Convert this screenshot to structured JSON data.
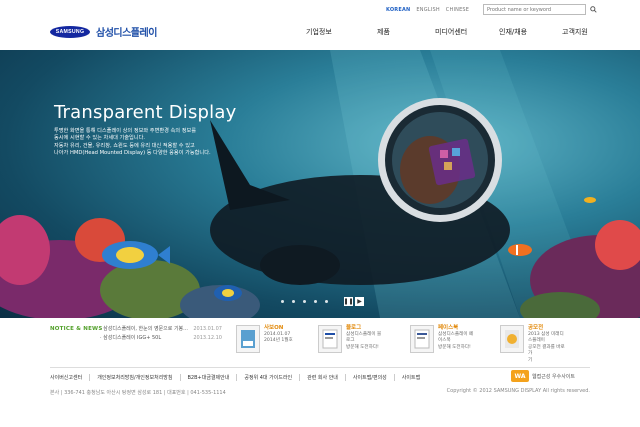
{
  "header": {
    "languages": [
      "KOREAN",
      "ENGLISH",
      "CHINESE"
    ],
    "active_language": "KOREAN",
    "search_placeholder": "Product name or keyword",
    "brand_logo": "SAMSUNG",
    "brand_name": "삼성디스플레이",
    "nav": [
      "기업정보",
      "제품",
      "미디어센터",
      "인재/채용",
      "고객지원"
    ]
  },
  "hero": {
    "title": "Transparent Display",
    "description": [
      "투명한 화면을 통해 디스플레이 상의 정보와 주변환경 속의 정보를",
      "동시에 시현할 수 있는 차세대 기술입니다.",
      "자동차 유리, 건물, 유리창, 쇼윈도 등에 유리 대신 적용할 수 있고",
      "나아가 HMD(Head Mounted Display) 등 다양한 응용이 가능합니다."
    ],
    "slide_count": 5,
    "controls": [
      "❚❚",
      "▶"
    ]
  },
  "notice": {
    "label": "NOTICE & NEWS",
    "items": [
      {
        "title": "· 삼성디스플레이, 한눈의 영문으로 기봉...",
        "date": "2013.01.07"
      },
      {
        "title": "· 삼성디스플레이 IGG+ 50L",
        "date": "2013.12.10"
      }
    ]
  },
  "promos": [
    {
      "title": "사보ON",
      "lines": [
        "2014.01.07",
        "2014년 1월호"
      ],
      "icon": "magazine-icon"
    },
    {
      "title": "블로그",
      "lines": [
        "삼성디스플레이 블로그",
        "방문해 도전하다!"
      ],
      "icon": "blog-icon"
    },
    {
      "title": "페이스북",
      "lines": [
        "삼성디스플레이 페이스북",
        "방문해 도전하다!"
      ],
      "icon": "facebook-icon"
    },
    {
      "title": "공모전",
      "lines": [
        "2013 삼성 미래디스플레이",
        "공모전 결과를 바로가",
        "기"
      ],
      "icon": "contest-icon"
    }
  ],
  "footer": {
    "links": [
      "사이버신고센터",
      "개인정보처리방침/개인정보처리방침",
      "B2B+대금결제안내",
      "공정위 4대 가이드라인",
      "관련 회사 안내",
      "사이트맵/편의성",
      "사이트맵"
    ],
    "address": "본사 | 336-741 충청남도 아산시 탕정면 삼성로 181 | 대표번호 | 041-535-1114",
    "copyright": "Copyright © 2012 SAMSUNG DISPLAY All rights reserved.",
    "wa_mark": "WA",
    "wa_text": "웹접근성 우수사이트"
  },
  "colors": {
    "accent": "#1f60c4",
    "notice_green": "#52a02a",
    "promo_orange": "#e28a0c",
    "brand_blue": "#1428a0"
  }
}
